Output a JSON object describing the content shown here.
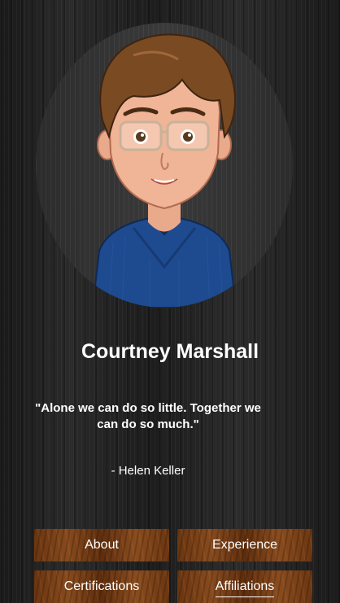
{
  "profile": {
    "name": "Courtney Marshall",
    "quote": "\"Alone we can do so little. Together we can do so much.\"",
    "author": "- Helen Keller"
  },
  "nav": {
    "about": "About",
    "experience": "Experience",
    "certifications": "Certifications",
    "affiliations": "Affiliations",
    "active": "affiliations"
  },
  "colors": {
    "button_wood": "#7a4015",
    "text": "#ffffff",
    "background": "#222222"
  }
}
